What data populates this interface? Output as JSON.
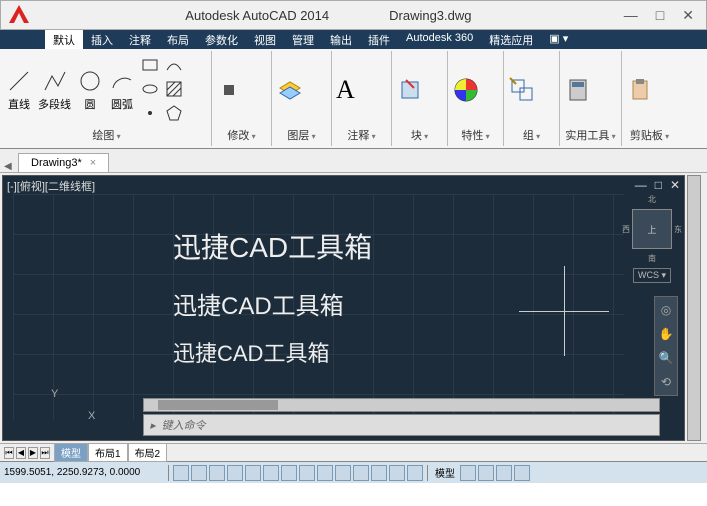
{
  "title": {
    "app": "Autodesk AutoCAD 2014",
    "doc": "Drawing3.dwg"
  },
  "ribbon": {
    "tabs": [
      "默认",
      "插入",
      "注释",
      "布局",
      "参数化",
      "视图",
      "管理",
      "输出",
      "插件",
      "Autodesk 360",
      "精选应用",
      "▣ ▾"
    ],
    "active": 0,
    "panels": {
      "draw": {
        "name": "绘图",
        "tools": [
          "直线",
          "多段线",
          "圆",
          "圆弧"
        ]
      },
      "modify": {
        "name": "修改"
      },
      "layer": {
        "name": "图层"
      },
      "annot": {
        "name": "注释"
      },
      "block": {
        "name": "块"
      },
      "prop": {
        "name": "特性"
      },
      "group": {
        "name": "组"
      },
      "util": {
        "name": "实用工具"
      },
      "clip": {
        "name": "剪贴板"
      }
    }
  },
  "docTabs": [
    {
      "label": "Drawing3*",
      "close": "×"
    }
  ],
  "canvas": {
    "header": "[-][俯视][二维线框]",
    "controls": [
      "—",
      "□",
      "✕"
    ],
    "texts": [
      "迅捷CAD工具箱",
      "迅捷CAD工具箱",
      "迅捷CAD工具箱"
    ],
    "ucs": {
      "y": "Y",
      "x": "X"
    },
    "viewcube": {
      "face": "上",
      "n": "北",
      "w": "西",
      "e": "东",
      "s": "南",
      "wcs": "WCS ▾"
    },
    "cmd": {
      "prompt": "▸",
      "placeholder": "键入命令"
    }
  },
  "layoutTabs": {
    "nav": [
      "⏮",
      "◀",
      "▶",
      "⏭"
    ],
    "tabs": [
      "模型",
      "布局1",
      "布局2"
    ],
    "active": 0
  },
  "status": {
    "coords": "1599.5051, 2250.9273, 0.0000",
    "model": "模型"
  }
}
